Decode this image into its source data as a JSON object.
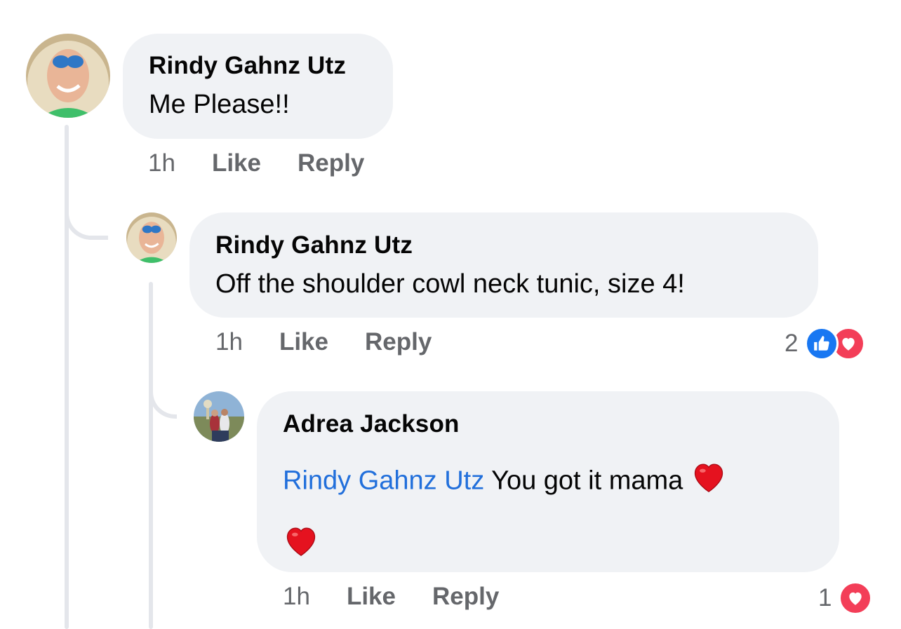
{
  "comments": [
    {
      "author": "Rindy Gahnz Utz",
      "text": "Me Please!!",
      "time": "1h",
      "like_label": "Like",
      "reply_label": "Reply"
    },
    {
      "author": "Rindy Gahnz Utz",
      "text": "Off the shoulder cowl neck tunic, size 4!",
      "time": "1h",
      "like_label": "Like",
      "reply_label": "Reply",
      "reaction_count": "2",
      "reactions": [
        "like-icon",
        "love-icon"
      ]
    },
    {
      "author": "Adrea Jackson",
      "mention": "Rindy Gahnz Utz",
      "text": " You got it mama ",
      "emoji": [
        "red-heart-emoji",
        "red-heart-emoji"
      ],
      "time": "1h",
      "like_label": "Like",
      "reply_label": "Reply",
      "reaction_count": "1",
      "reactions": [
        "love-icon"
      ]
    }
  ],
  "colors": {
    "bubble": "#f0f2f5",
    "meta_text": "#65676b",
    "mention": "#216fdb",
    "like_blue": "#1877f2",
    "love_red": "#f33e58",
    "thread_line": "#e4e6eb"
  }
}
